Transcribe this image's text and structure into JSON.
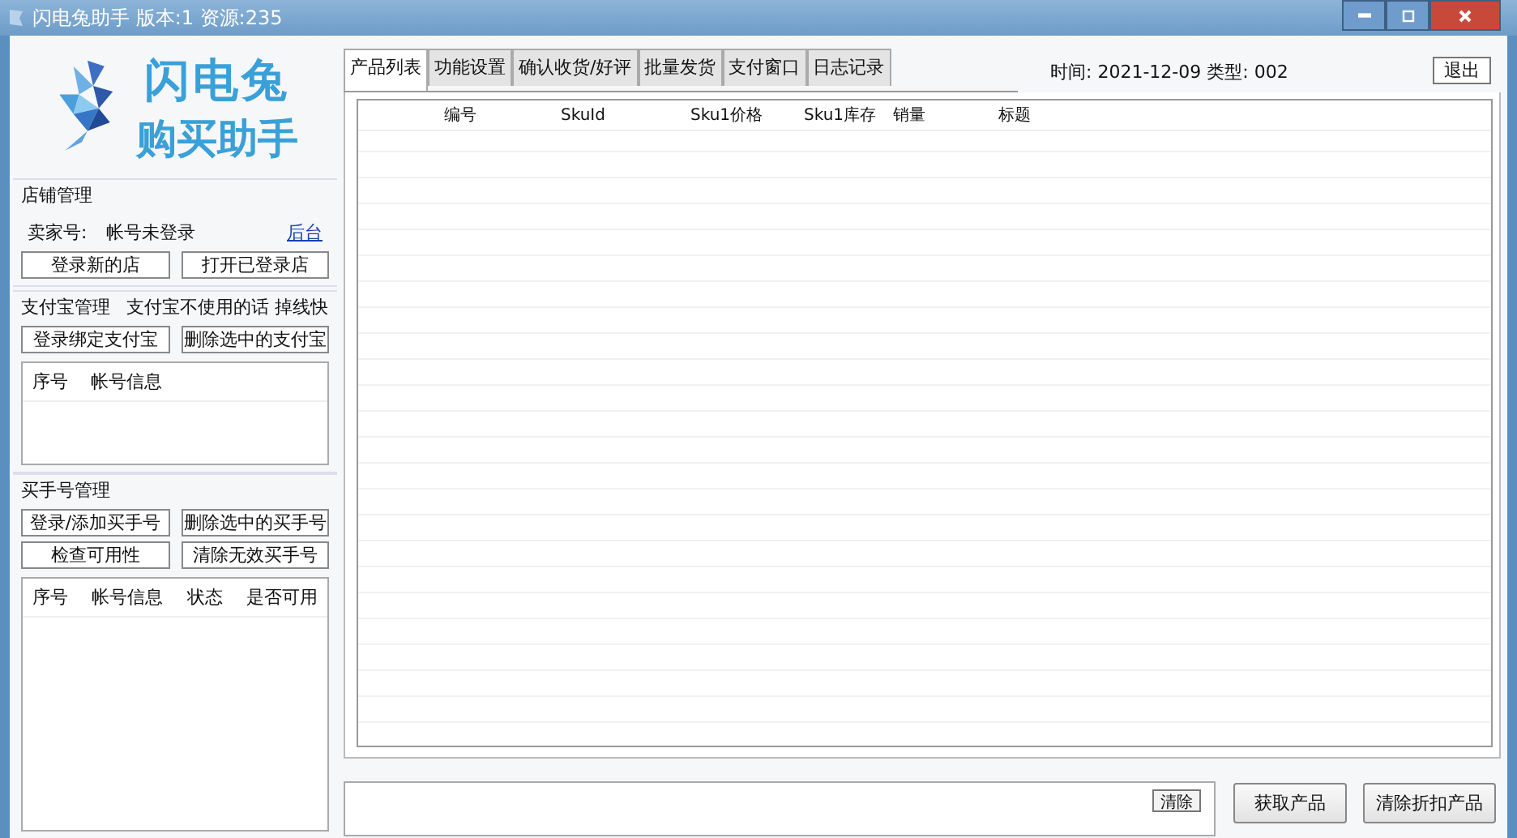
{
  "window": {
    "title": "闪电兔助手 版本:1 资源:235"
  },
  "logo": {
    "line_1": "闪电兔",
    "line_2": "购买助手"
  },
  "shop": {
    "title": "店铺管理",
    "seller_label": "卖家号:",
    "seller_value": "帐号未登录",
    "link": "后台",
    "buttons": [
      "登录新的店",
      "打开已登录店"
    ]
  },
  "alipay": {
    "title": "支付宝管理",
    "note": "支付宝不使用的话 掉线快",
    "buttons": [
      "登录绑定支付宝",
      "删除选中的支付宝"
    ],
    "columns": [
      "序号",
      "帐号信息"
    ]
  },
  "buyers": {
    "title": "买手号管理",
    "buttons": [
      "登录/添加买手号",
      "删除选中的买手号",
      "检查可用性",
      "清除无效买手号"
    ],
    "columns": [
      "序号",
      "帐号信息",
      "状态",
      "是否可用"
    ]
  },
  "tabs": [
    {
      "label": "产品列表",
      "selected": true
    },
    {
      "label": "功能设置",
      "selected": false
    },
    {
      "label": "确认收货/好评",
      "selected": false
    },
    {
      "label": "批量发货",
      "selected": false
    },
    {
      "label": "支付窗口",
      "selected": false
    },
    {
      "label": "日志记录",
      "selected": false
    }
  ],
  "info": "时间: 2021-12-09 类型: 002",
  "exit_button": "退出",
  "products": {
    "columns": [
      "编号",
      "SkuId",
      "Sku1价格",
      "Sku1库存",
      "销量",
      "标题"
    ]
  },
  "log": {
    "clear_button": "清除"
  },
  "actions": [
    "获取产品",
    "清除折扣产品"
  ]
}
